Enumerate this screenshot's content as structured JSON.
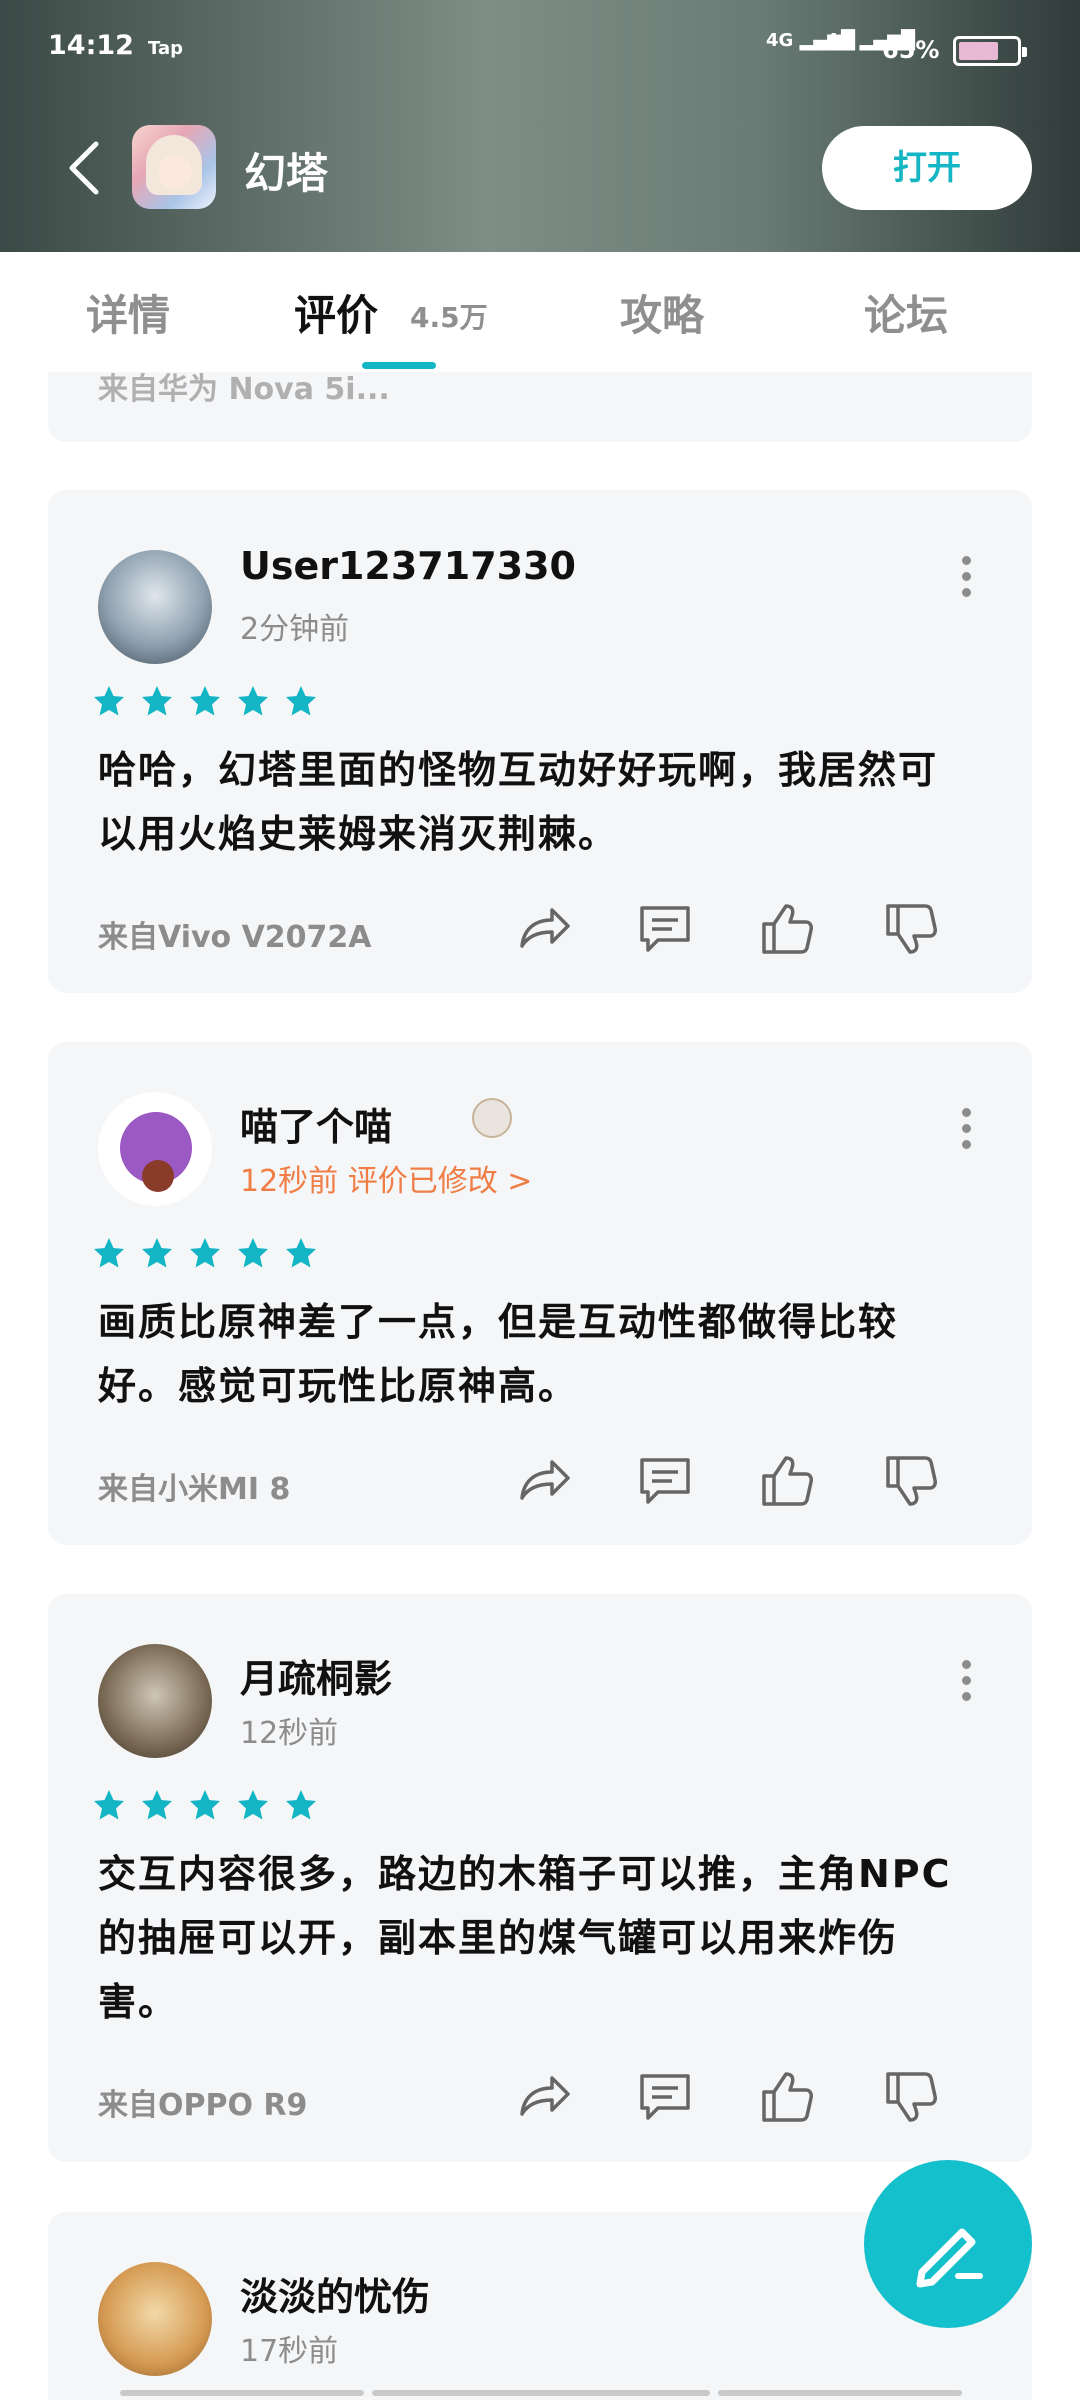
{
  "status_bar": {
    "time": "14:12",
    "carrier": "Tap",
    "signal1": "4G",
    "signal2": "4G",
    "battery": "65%"
  },
  "header": {
    "title": "幻塔",
    "open_button": "打开"
  },
  "tabs": [
    {
      "label": "详情",
      "active": false
    },
    {
      "label": "评价",
      "count": "4.5万",
      "active": true
    },
    {
      "label": "攻略",
      "active": false
    },
    {
      "label": "论坛",
      "active": false
    }
  ],
  "partial_card": {
    "device": "来自华为 Nova 5i..."
  },
  "reviews": [
    {
      "user": "User123717330",
      "time": "2分钟前",
      "stars": 5,
      "text": "哈哈，幻塔里面的怪物互动好好玩啊，我居然可以用火焰史莱姆来消灭荆棘。",
      "device": "来自Vivo V2072A"
    },
    {
      "user": "喵了个喵",
      "time": "12秒前 评价已修改 >",
      "stars": 5,
      "text": "画质比原神差了一点，但是互动性都做得比较好。感觉可玩性比原神高。",
      "device": "来自小米MI 8"
    },
    {
      "user": "月疏桐影",
      "time": "12秒前",
      "stars": 5,
      "text": "交互内容很多，路边的木箱子可以推，主角NPC的抽屉可以开，副本里的煤气罐可以用来炸伤害。",
      "device": "来自OPPO R9"
    },
    {
      "user": "淡淡的忧伤",
      "time": "17秒前"
    }
  ],
  "colors": {
    "accent": "#14b5c4",
    "modified": "#ef7d45",
    "card_bg": "#f5f6f8"
  }
}
